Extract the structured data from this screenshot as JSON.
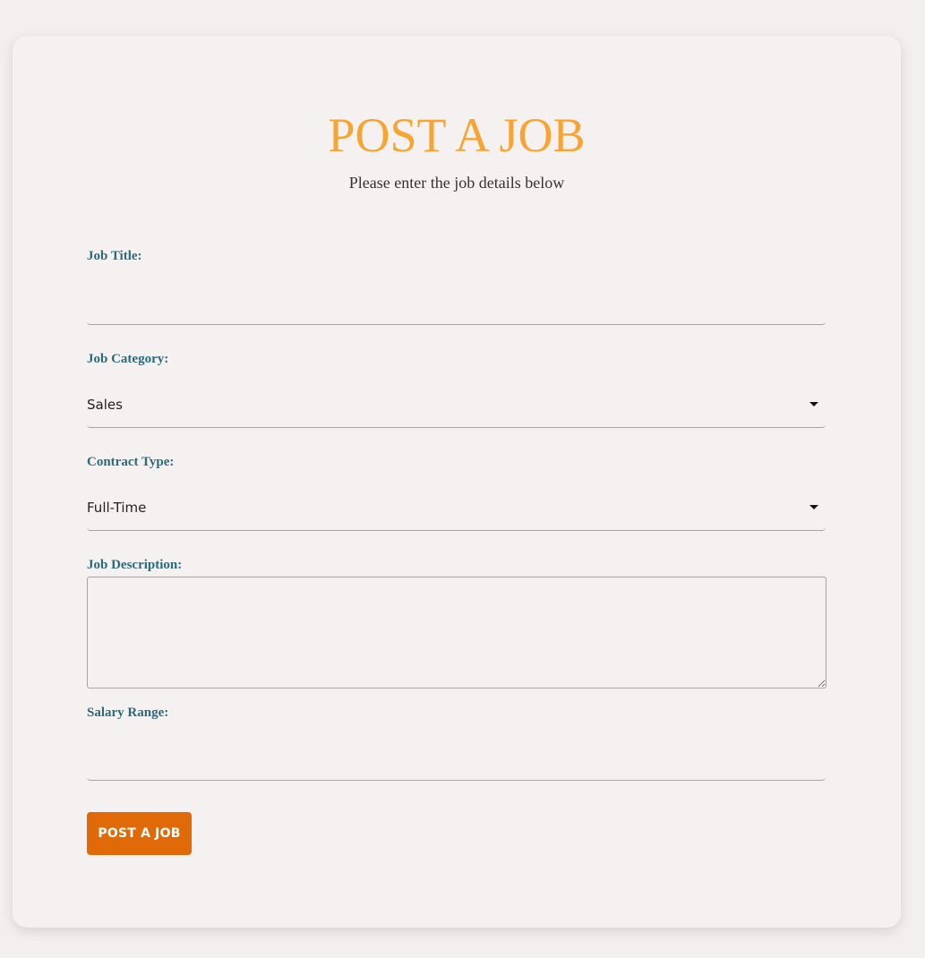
{
  "header": {
    "title": "POST A JOB",
    "subtitle": "Please enter the job details below"
  },
  "form": {
    "job_title": {
      "label": "Job Title:",
      "value": ""
    },
    "job_category": {
      "label": "Job Category:",
      "value": "Sales"
    },
    "contract_type": {
      "label": "Contract Type:",
      "value": "Full-Time"
    },
    "job_description": {
      "label": "Job Description:",
      "value": ""
    },
    "salary_range": {
      "label": "Salary Range:",
      "value": ""
    },
    "submit_label": "POST A JOB"
  },
  "colors": {
    "title": "#f7a530",
    "label": "#2b6a7a",
    "button": "#e06a08",
    "background": "#f4efef"
  },
  "icons": {
    "select_caret": "caret-down-icon"
  }
}
